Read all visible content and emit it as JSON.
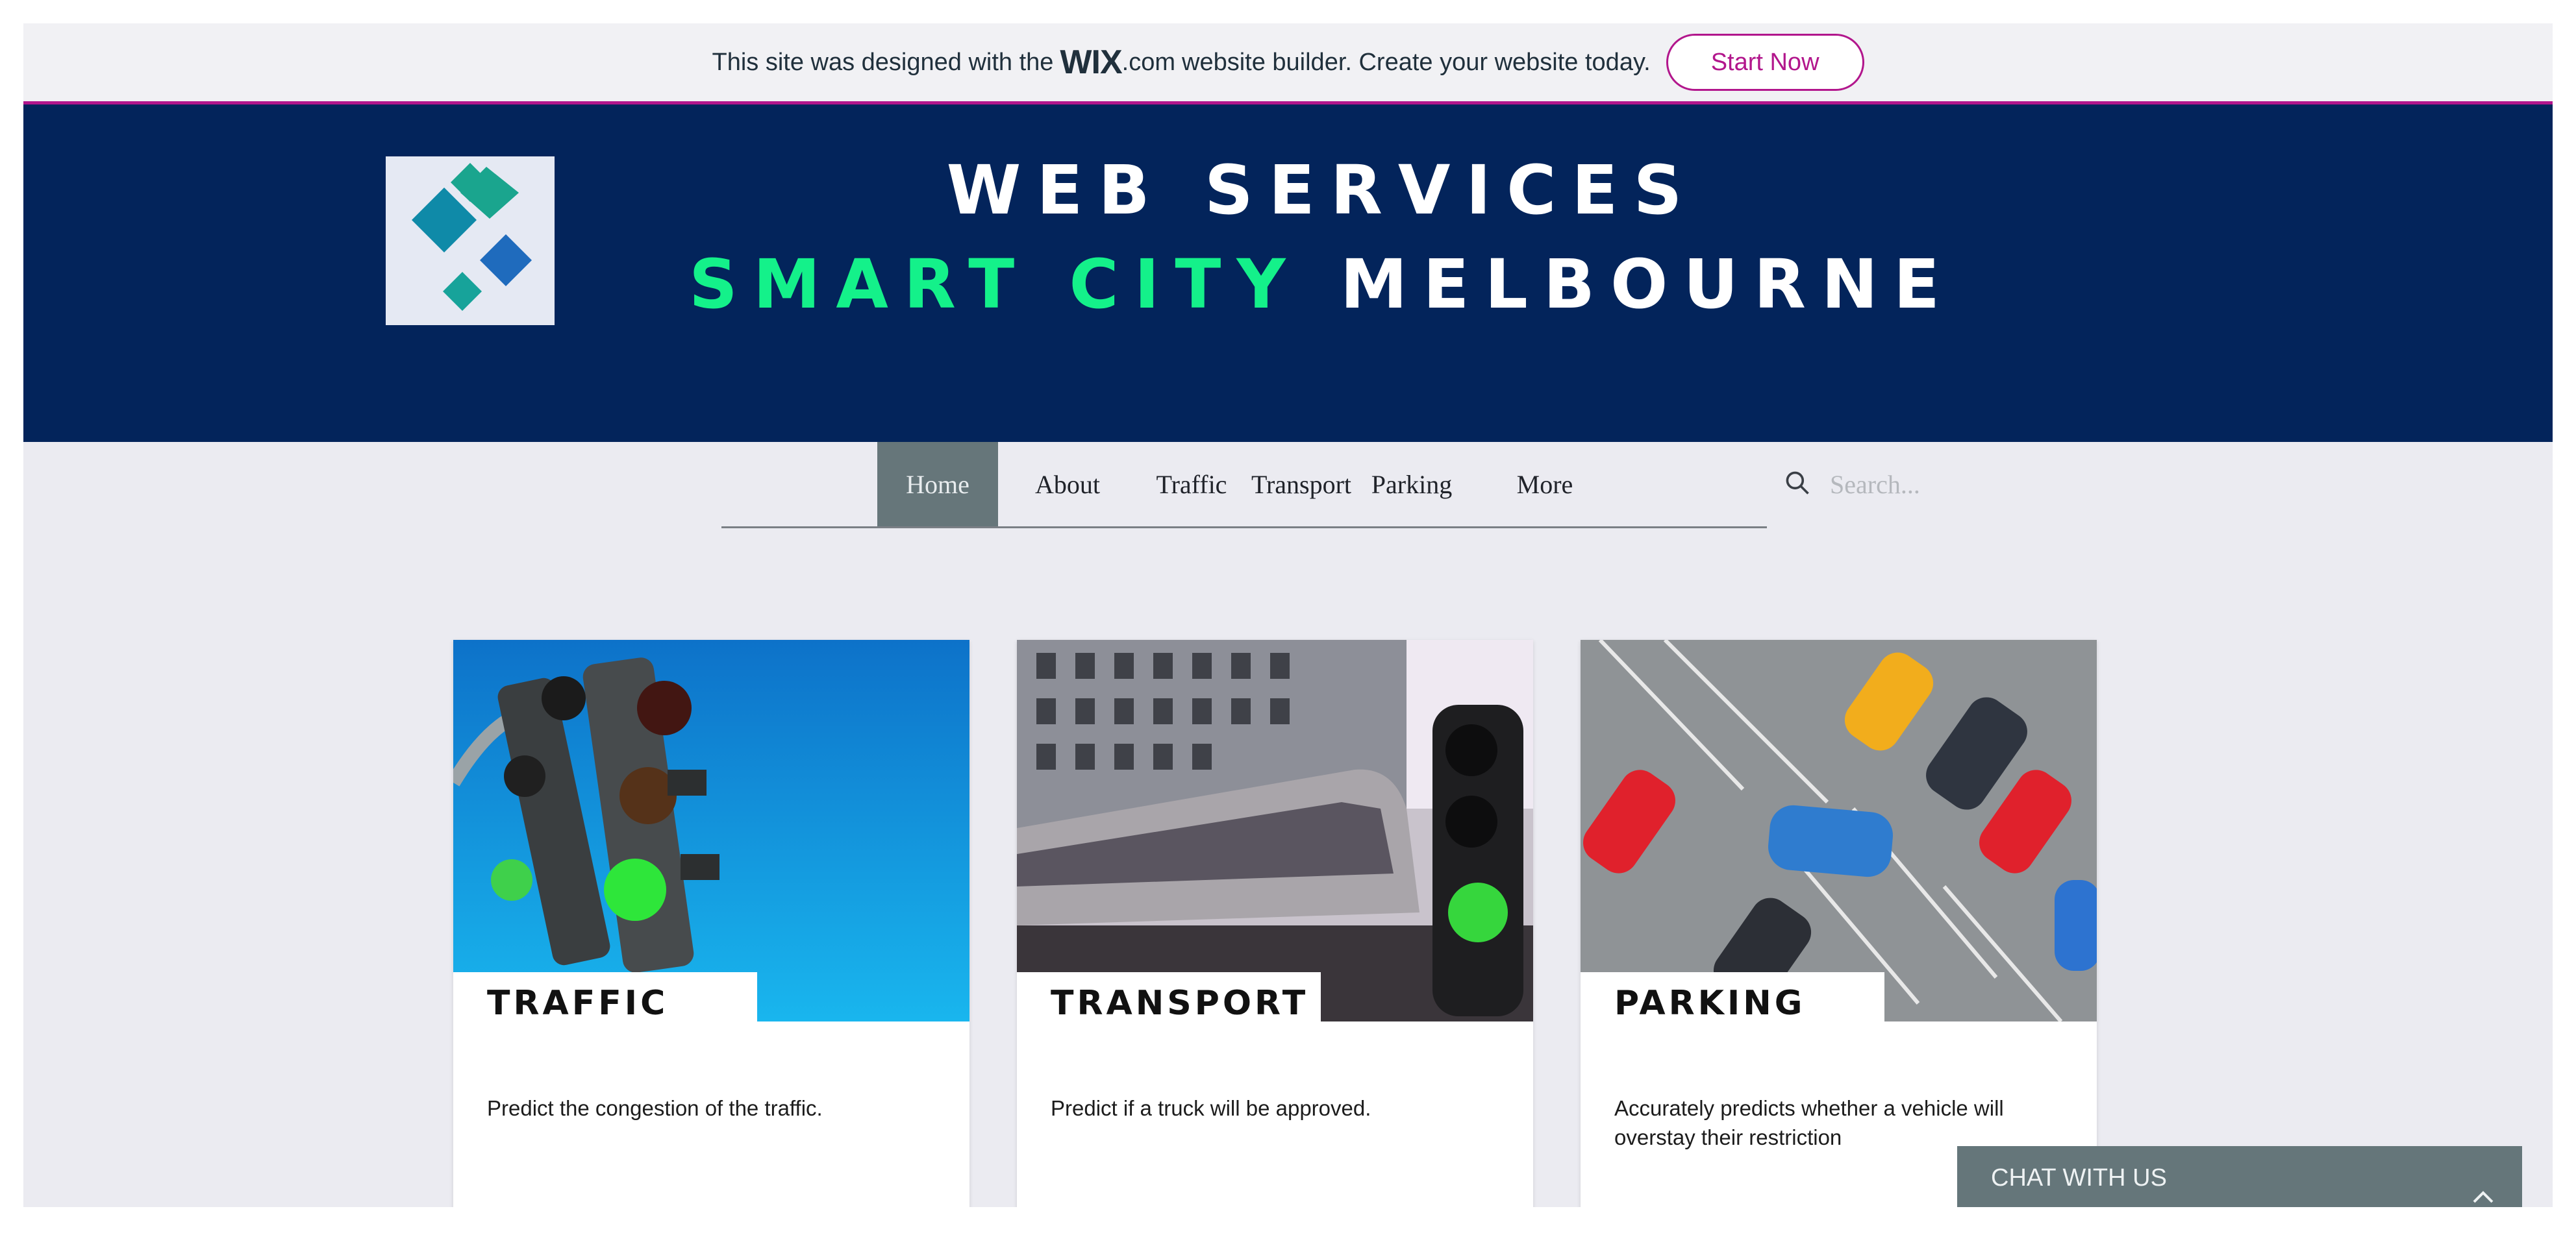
{
  "wix_banner": {
    "text_before": "This site was designed with the",
    "brand": "WIX",
    "brand_suffix": ".com",
    "text_after": "website builder. Create your website today.",
    "button_label": "Start Now"
  },
  "header": {
    "line1": "WEB SERVICES",
    "line2_green": "SMART CITY",
    "line2_white": "MELBOURNE",
    "logo_icon": "diamond-logo-icon"
  },
  "nav": {
    "items": [
      {
        "label": "Home",
        "active": true
      },
      {
        "label": "About"
      },
      {
        "label": "Traffic"
      },
      {
        "label": "Transport"
      },
      {
        "label": "Parking"
      },
      {
        "label": "More"
      }
    ],
    "search_placeholder": "Search...",
    "search_icon": "search-icon"
  },
  "cards": [
    {
      "title": "TRAFFIC",
      "description": "Predict the congestion of the traffic.",
      "image": "traffic-lights-image"
    },
    {
      "title": "TRANSPORT",
      "description": "Predict if a truck will be approved.",
      "image": "train-image"
    },
    {
      "title": "PARKING",
      "description": "Accurately predicts whether a vehicle will overstay their restriction",
      "image": "parking-lot-image"
    }
  ],
  "chat": {
    "label": "CHAT WITH US",
    "icon": "chevron-up-icon"
  },
  "colors": {
    "header_bg": "#03245b",
    "accent_green": "#14f18a",
    "wix_magenta": "#b2168c",
    "nav_active_bg": "#66767a",
    "page_bg": "#ebebf1"
  }
}
